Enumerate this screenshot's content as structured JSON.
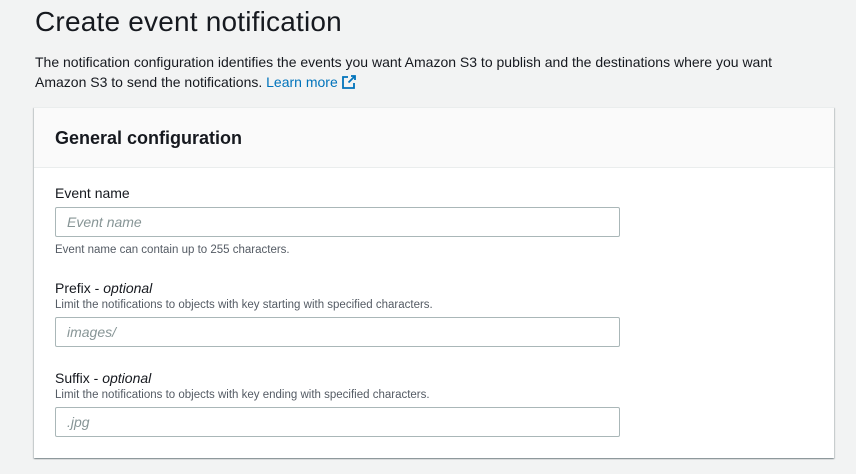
{
  "header": {
    "title": "Create event notification",
    "description": "The notification configuration identifies the events you want Amazon S3 to publish and the destinations where you want Amazon S3 to send the notifications.",
    "learn_more": "Learn more",
    "learn_more_icon": "external-link-icon"
  },
  "colors": {
    "link": "#0073bb",
    "text": "#16191f",
    "muted": "#545b64",
    "background": "#f2f3f3"
  },
  "general_configuration": {
    "title": "General configuration",
    "event_name": {
      "label": "Event name",
      "placeholder": "Event name",
      "value": "",
      "hint": "Event name can contain up to 255 characters."
    },
    "prefix": {
      "label": "Prefix",
      "optional": "optional",
      "separator": " - ",
      "description": "Limit the notifications to objects with key starting with specified characters.",
      "placeholder": "images/",
      "value": ""
    },
    "suffix": {
      "label": "Suffix",
      "optional": "optional",
      "separator": " - ",
      "description": "Limit the notifications to objects with key ending with specified characters.",
      "placeholder": ".jpg",
      "value": ""
    }
  }
}
